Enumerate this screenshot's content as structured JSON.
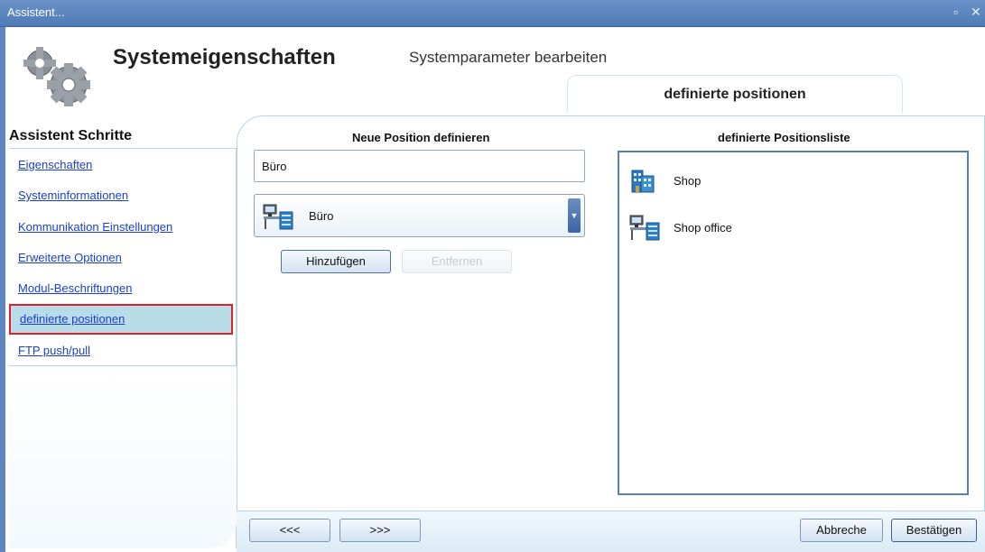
{
  "window": {
    "title": "Assistent...",
    "controls": [
      "restore-icon",
      "close-icon"
    ]
  },
  "header": {
    "title": "Systemeigenschaften",
    "subtitle": "Systemparameter bearbeiten",
    "active_tab": "definierte positionen"
  },
  "sidebar": {
    "heading": "Assistent Schritte",
    "items": [
      {
        "label": "Eigenschaften"
      },
      {
        "label": "Systeminformationen"
      },
      {
        "label": "Kommunikation Einstellungen"
      },
      {
        "label": "Erweiterte Optionen"
      },
      {
        "label": "Modul-Beschriftungen"
      },
      {
        "label": "definierte positionen",
        "selected": true
      },
      {
        "label": "FTP push/pull"
      }
    ]
  },
  "new_position": {
    "heading": "Neue Position definieren",
    "name_value": "Büro",
    "type_select": {
      "selected": "Büro",
      "icon": "office-desk-icon"
    },
    "add_label": "Hinzufügen",
    "remove_label": "Entfernen"
  },
  "position_list": {
    "heading": "definierte Positionsliste",
    "items": [
      {
        "label": "Shop",
        "icon": "building-icon"
      },
      {
        "label": "Shop office",
        "icon": "office-desk-icon"
      }
    ]
  },
  "footer": {
    "prev_label": "<<<",
    "next_label": ">>>",
    "cancel_label": "Abbreche",
    "confirm_label": "Bestätigen"
  },
  "colors": {
    "titlebar": "#5b84bd",
    "link": "#1a3fd0",
    "selected_bg": "#b8dce8",
    "selected_border": "#e0202a",
    "panel_border": "#b7d3ea"
  }
}
